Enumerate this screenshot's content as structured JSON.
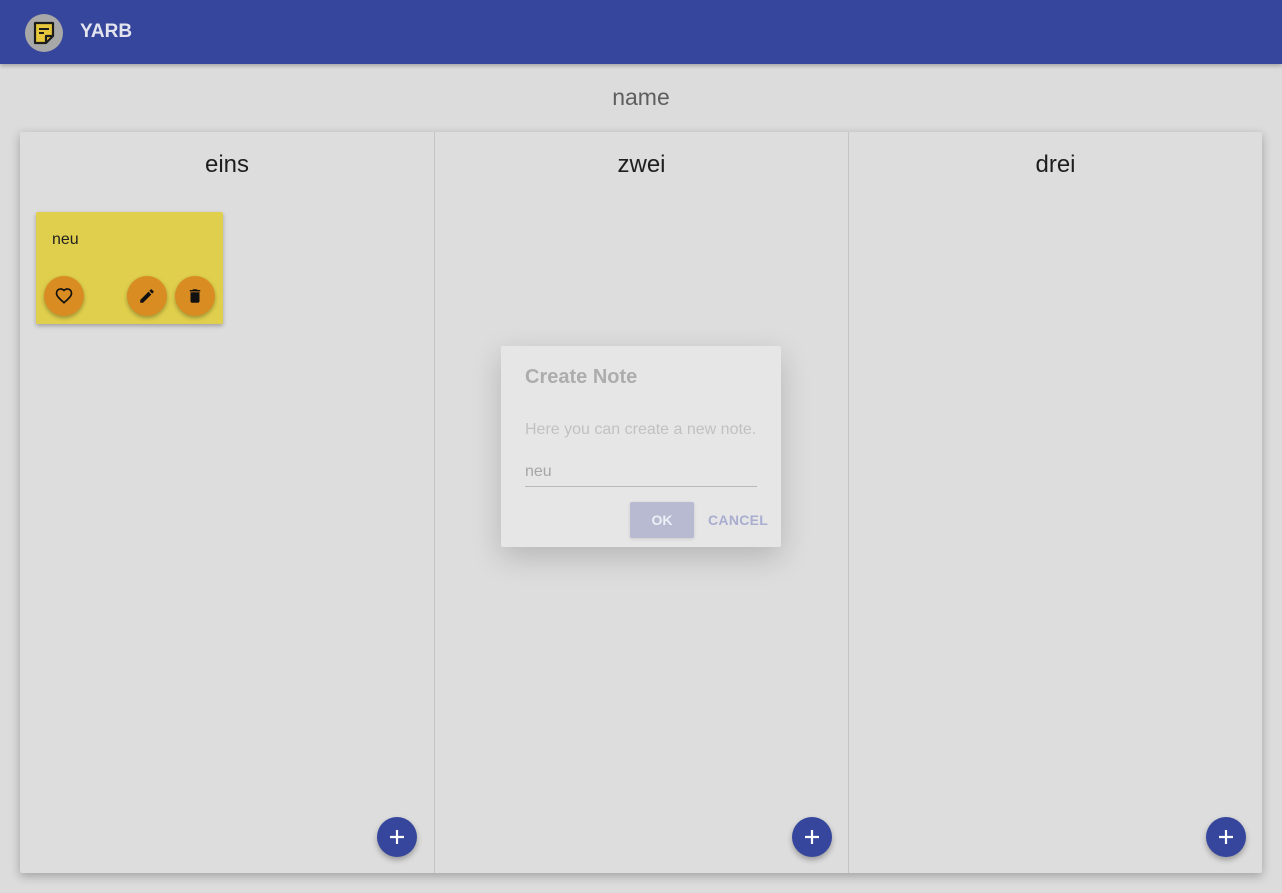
{
  "app": {
    "title": "YARB",
    "logo_icon": "note-icon",
    "accent": "#35469c"
  },
  "board": {
    "name": "name"
  },
  "columns": [
    {
      "title": "eins",
      "add_icon": "plus-icon"
    },
    {
      "title": "zwei",
      "add_icon": "plus-icon"
    },
    {
      "title": "drei",
      "add_icon": "plus-icon"
    }
  ],
  "notes": [
    {
      "text": "neu",
      "color": "#e0cf4c",
      "actions": [
        "heart-icon",
        "pencil-icon",
        "trash-icon"
      ]
    }
  ],
  "dialog": {
    "title": "Create Note",
    "description": "Here you can create a new note.",
    "input_value": "neu",
    "ok_label": "OK",
    "cancel_label": "CANCEL"
  }
}
